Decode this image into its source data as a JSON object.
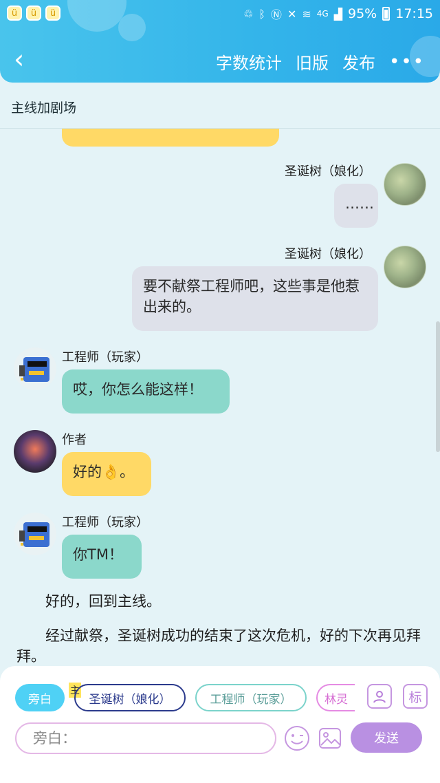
{
  "status_bar": {
    "battery": "95%",
    "time": "17:15",
    "signal": "4G"
  },
  "nav": {
    "back_icon": "chevron-left-icon",
    "word_count": "字数统计",
    "old_version": "旧版",
    "publish": "发布",
    "more": "•••"
  },
  "subtitle": "主线加剧场",
  "messages": [
    {
      "speaker": "圣诞树（娘化）",
      "text": "……",
      "side": "right"
    },
    {
      "speaker": "圣诞树（娘化）",
      "text": "要不献祭工程师吧，这些事是他惹出来的。",
      "side": "right"
    },
    {
      "speaker": "工程师（玩家）",
      "text": "哎，你怎么能这样！",
      "side": "left"
    },
    {
      "speaker": "作者",
      "text": "好的👌。",
      "side": "left"
    },
    {
      "speaker": "工程师（玩家）",
      "text": "你TM！",
      "side": "left"
    }
  ],
  "narration": [
    "好的，回到主线。",
    "经过献祭，圣诞树成功的结束了这次危机，好的下次再见拜拜。"
  ],
  "roles": {
    "active": "旁白",
    "main_tag": "主",
    "items": [
      "圣诞树（娘化）",
      "工程师（玩家）",
      "林灵"
    ],
    "biao": "标"
  },
  "input": {
    "placeholder": "旁白："
  },
  "send": "发送",
  "colors": {
    "header": "#33b4ea",
    "yellow_bubble": "#ffd966",
    "teal_bubble": "#8bd8cb",
    "grey_bubble": "#dee1ea",
    "send": "#b990e2"
  }
}
